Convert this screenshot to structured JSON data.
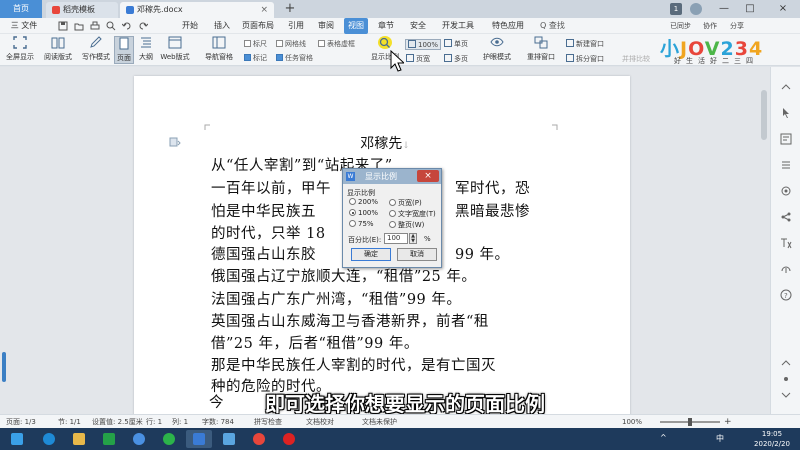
{
  "tabs": {
    "home": "首页",
    "templates": "稻壳模板",
    "document": "邓稼先.docx",
    "add": "+"
  },
  "window": {
    "badge": "1",
    "minimize": "—",
    "maximize": "□",
    "close": "×"
  },
  "menu": {
    "file": "三 文件",
    "items": [
      "开始",
      "插入",
      "页面布局",
      "引用",
      "审阅",
      "视图",
      "章节",
      "安全",
      "开发工具",
      "特色应用"
    ],
    "active": "视图",
    "search": "Q 查找",
    "right_tools": [
      "已同步",
      "协作",
      "分享"
    ]
  },
  "ribbon": {
    "buttons": [
      "全屏显示",
      "阅读版式",
      "写作模式",
      "页面",
      "大纲",
      "Web版式",
      "导航窗格",
      "显示比例",
      "单页",
      "多页",
      "护眼模式",
      "重排窗口",
      "拆分窗口",
      "新建窗口",
      "并排比较"
    ],
    "checkboxes": [
      "标尺",
      "网格线",
      "表格虚框",
      "标记",
      "任务窗格"
    ],
    "zoom_value": "100%",
    "page_width": "页宽"
  },
  "logo": {
    "letters": [
      "J",
      "O",
      "V",
      "2",
      "3",
      "4",
      ""
    ],
    "prefix": "小",
    "subtitle": "好生活好二三四"
  },
  "document": {
    "title": "邓稼先",
    "lines": [
      "从“任人宰割”到“站起来了”",
      "一百年以前，甲午战争后的军阀割据时代，恐",
      "怕是中华民族五千年历史中最黑暗最悲惨",
      "的时代，只举 1898 年为例：",
      "德国强占山东胶州湾，“租借”99 年。",
      "俄国强占辽宁旅顺大连，“租借”25 年。",
      "法国强占广东广州湾，“租借”99 年。",
      "英国强占山东威海卫与香港新界，前者“租",
      "借”25 年，后者“租借”99 年。",
      "那是中华民族任人宰割的时代，是有亡国灭",
      "种的危险的时代。"
    ],
    "visible_lines": [
      "从“任人宰割”到“站起来了”",
      "一百年以前，甲午",
      "怕是中华民族五",
      "的时代，只举 18",
      "德国强占山东胶",
      "俄国强占辽宁旅顺大连，“租借”25 年。",
      "法国强占广东广州湾，“租借”99 年。",
      "英国强占山东威海卫与香港新界，前者“租",
      "借”25 年，后者“租借”99 年。",
      "那是中华民族任人宰割的时代，是有亡国灭",
      "种的危险的时代。"
    ],
    "right_fragments": [
      "军时代，恐",
      "黑暗最悲惨",
      "99 年。"
    ],
    "cut_char": "今"
  },
  "dialog": {
    "title": "显示比例",
    "group": "显示比例",
    "options": [
      {
        "label": "200%",
        "selected": false
      },
      {
        "label": "页宽(P)",
        "selected": false
      },
      {
        "label": "100%",
        "selected": true
      },
      {
        "label": "文字宽度(T)",
        "selected": false
      },
      {
        "label": "75%",
        "selected": false
      },
      {
        "label": "整页(W)",
        "selected": false
      }
    ],
    "percent_label": "百分比(E):",
    "percent_value": "100",
    "percent_sign": "%",
    "ok": "确定",
    "cancel": "取消",
    "close": "×"
  },
  "caption": "即可选择你想要显示的页面比例",
  "status": {
    "page": "页面: 1/3",
    "section": "节: 1/1",
    "setting": "设置值: 2.5厘米",
    "row": "行: 1",
    "col": "列: 1",
    "words": "字数: 784",
    "spell": "拼写检查",
    "proof": "文档校对",
    "unprotected": "文档未保护",
    "zoom": "100%"
  },
  "taskbar": {
    "ime": "中",
    "date": "2020/2/20",
    "time": "19:05"
  },
  "colors": {
    "accent": "#4a8fd6",
    "taskbar": "#1e3a5c",
    "dialog_close": "#c6463c"
  }
}
